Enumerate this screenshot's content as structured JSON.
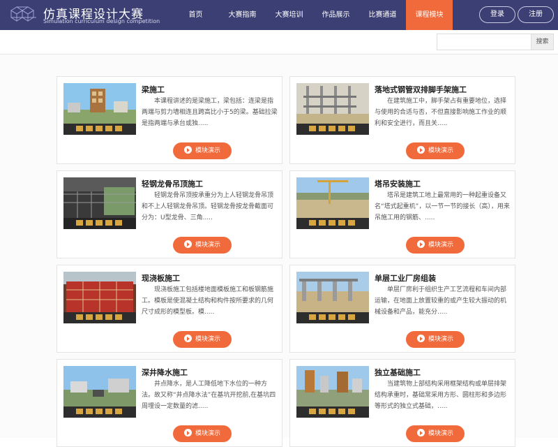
{
  "header": {
    "title": "仿真课程设计大赛",
    "subtitle": "Simulation curriculum design competition",
    "nav": [
      "首页",
      "大赛指南",
      "大赛培训",
      "作品展示",
      "比赛通道",
      "课程模块"
    ],
    "active_nav": 5,
    "login_label": "登录",
    "register_label": "注册"
  },
  "search": {
    "value": "",
    "placeholder": "",
    "button_label": "搜索"
  },
  "courses": [
    {
      "title": "梁施工",
      "description": "本课程讲述的是梁施工，梁包括：连梁是指两端与剪力墙相连且跨高比小于5的梁。基础拉梁是指两端与承台或独.....",
      "button_label": "模块演示"
    },
    {
      "title": "落地式钢管双排脚手架施工",
      "description": "在建筑施工中，脚手架占有重要地位，选择与使用的合适与否，不但直接影响施工作业的顺利和安全进行，而且关.....",
      "button_label": "模块演示"
    },
    {
      "title": "轻钢龙骨吊顶施工",
      "description": "轻钢龙骨吊顶按承重分为上人轻钢龙骨吊顶和不上人轻钢龙骨吊顶。轻钢龙骨按龙骨截面可分为：U型龙骨、三角.....",
      "button_label": "模块演示"
    },
    {
      "title": "塔吊安装施工",
      "description": "塔吊是建筑工地上最常用的一种起重设备又名“塔式起重机”，以一节一节的接长（高），用来吊施工用的钢筋、.....",
      "button_label": "模块演示"
    },
    {
      "title": "现浇板施工",
      "description": "现浇板施工包括楼地面模板施工和板钢筋施工。模板是使混凝土结构和构件按所要求的几何尺寸成形的模型板。模.....",
      "button_label": "模块演示"
    },
    {
      "title": "单层工业厂房组装",
      "description": "单层厂房利于组织生产工艺流程和车间内部运输，在地面上放置较重的或产生较大振动的机械设备和产品，能充分.....",
      "button_label": "模块演示"
    },
    {
      "title": "深井降水施工",
      "description": "井点降水，是人工降低地下水位的一种方法。故又称“井点降水法”在基坑开挖前,在基坑四周埋设一定数量的滤.....",
      "button_label": "模块演示"
    },
    {
      "title": "独立基础施工",
      "description": "当建筑物上部结构采用框架结构或单层排架结构承重时，基础常采用方形、圆柱形和多边形等形式的独立式基础，.....",
      "button_label": "模块演示"
    }
  ],
  "colors": {
    "header_bg": "#3b3f73",
    "accent": "#f06a3c"
  }
}
